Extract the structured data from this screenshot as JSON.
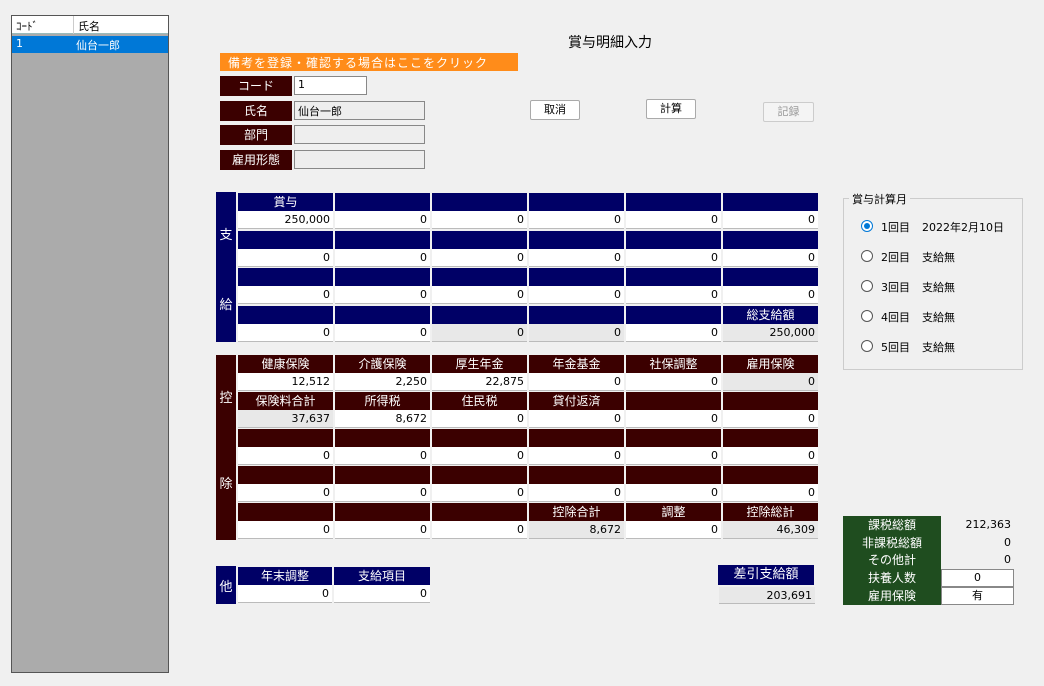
{
  "list": {
    "col_code": "ｺｰﾄﾞ",
    "col_name": "氏名",
    "rows": [
      {
        "code": "1",
        "name": "仙台一郎"
      }
    ]
  },
  "title": "賞与明細入力",
  "memo_button": "備考を登録・確認する場合はここをクリック",
  "form": {
    "code_label": "コード",
    "code_value": "1",
    "name_label": "氏名",
    "name_value": "仙台一郎",
    "dept_label": "部門",
    "dept_value": "",
    "emp_type_label": "雇用形態",
    "emp_type_value": ""
  },
  "buttons": {
    "cancel": "取消",
    "calc": "計算",
    "record": "記録"
  },
  "payment": {
    "side_top": "支",
    "side_bottom": "給",
    "rows": [
      {
        "headers": [
          "賞与",
          "",
          "",
          "",
          "",
          ""
        ],
        "values": [
          "250,000",
          "0",
          "0",
          "0",
          "0",
          "0"
        ]
      },
      {
        "headers": [
          "",
          "",
          "",
          "",
          "",
          ""
        ],
        "values": [
          "0",
          "0",
          "0",
          "0",
          "0",
          "0"
        ]
      },
      {
        "headers": [
          "",
          "",
          "",
          "",
          "",
          ""
        ],
        "values": [
          "0",
          "0",
          "0",
          "0",
          "0",
          "0"
        ]
      },
      {
        "headers": [
          "",
          "",
          "",
          "",
          "",
          "総支給額"
        ],
        "values": [
          "0",
          "0",
          "0",
          "0",
          "0",
          "250,000"
        ]
      }
    ]
  },
  "deduction": {
    "side_top": "控",
    "side_bottom": "除",
    "rows": [
      {
        "headers": [
          "健康保険",
          "介護保険",
          "厚生年金",
          "年金基金",
          "社保調整",
          "雇用保険"
        ],
        "values": [
          "12,512",
          "2,250",
          "22,875",
          "0",
          "0",
          "0"
        ]
      },
      {
        "headers": [
          "保険料合計",
          "所得税",
          "住民税",
          "貸付返済",
          "",
          ""
        ],
        "values": [
          "37,637",
          "8,672",
          "0",
          "0",
          "0",
          "0"
        ]
      },
      {
        "headers": [
          "",
          "",
          "",
          "",
          "",
          ""
        ],
        "values": [
          "0",
          "0",
          "0",
          "0",
          "0",
          "0"
        ]
      },
      {
        "headers": [
          "",
          "",
          "",
          "",
          "",
          ""
        ],
        "values": [
          "0",
          "0",
          "0",
          "0",
          "0",
          "0"
        ]
      },
      {
        "headers": [
          "",
          "",
          "",
          "控除合計",
          "調整",
          "控除総計"
        ],
        "values": [
          "0",
          "0",
          "0",
          "8,672",
          "0",
          "46,309"
        ]
      }
    ]
  },
  "other": {
    "side": "他",
    "headers": [
      "年末調整",
      "支給項目"
    ],
    "values": [
      "0",
      "0"
    ]
  },
  "net": {
    "label": "差引支給額",
    "value": "203,691"
  },
  "calc_month": {
    "title": "賞与計算月",
    "options": [
      {
        "label": "1回目",
        "detail": "2022年2月10日",
        "selected": true
      },
      {
        "label": "2回目",
        "detail": "支給無",
        "selected": false
      },
      {
        "label": "3回目",
        "detail": "支給無",
        "selected": false
      },
      {
        "label": "4回目",
        "detail": "支給無",
        "selected": false
      },
      {
        "label": "5回目",
        "detail": "支給無",
        "selected": false
      }
    ]
  },
  "summary": {
    "taxable_label": "課税総額",
    "taxable_value": "212,363",
    "nontaxable_label": "非課税総額",
    "nontaxable_value": "0",
    "other_label": "その他計",
    "other_value": "0",
    "dependents_label": "扶養人数",
    "dependents_value": "0",
    "employment_ins_label": "雇用保険",
    "employment_ins_value": "有"
  },
  "colors": {
    "navy": "#000066",
    "maroon": "#3b0000",
    "green": "#1f4d1f",
    "orange": "#ff8c1a",
    "select": "#0078d7"
  }
}
